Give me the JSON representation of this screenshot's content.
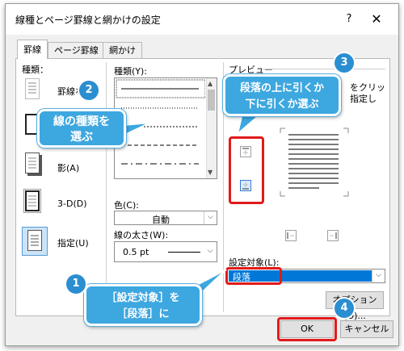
{
  "dialog": {
    "title": "線種とページ罫線と網かけの設定",
    "help": "?",
    "close": "✕"
  },
  "tabs": [
    {
      "label": "罫線",
      "active": true
    },
    {
      "label": "ページ罫線",
      "active": false
    },
    {
      "label": "網かけ",
      "active": false
    }
  ],
  "settings": {
    "label": "種類：",
    "items": [
      {
        "label": "罫線なし"
      },
      {
        "label": "囲む(X)"
      },
      {
        "label": "影(A)"
      },
      {
        "label": "3-D(D)"
      },
      {
        "label": "指定(U)"
      }
    ]
  },
  "style": {
    "label": "種類(Y):"
  },
  "color": {
    "label": "色(C):",
    "value": "自動"
  },
  "width": {
    "label": "線の太さ(W):",
    "value": "0.5 pt"
  },
  "preview": {
    "label": "プレビュー",
    "hint_line1": "をクリッ",
    "hint_line2": "指定し"
  },
  "apply_to": {
    "label": "設定対象(L):",
    "value": "段落"
  },
  "buttons": {
    "options": "オプション(O)...",
    "ok": "OK",
    "cancel": "キャンセル"
  },
  "annotations": {
    "callout1_line1": "［設定対象］を",
    "callout1_line2": "［段落］に",
    "callout2_line1": "線の種類を",
    "callout2_line2": "選ぶ",
    "callout3_line1": "段落の上に引くか",
    "callout3_line2": "下に引くか選ぶ",
    "badge1": "1",
    "badge2": "2",
    "badge3": "3",
    "badge4": "4"
  },
  "colors": {
    "callout": "#3da7e0",
    "badge": "#2a8ed1",
    "highlight": "#e21a1a",
    "selection": "#0078d7"
  }
}
